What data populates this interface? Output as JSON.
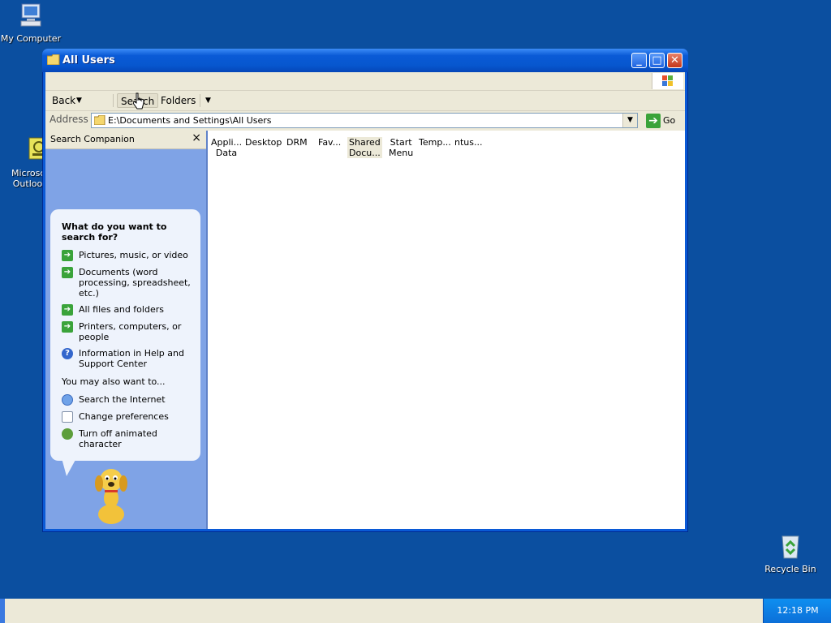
{
  "desktop": {
    "icons": [
      {
        "label": "My Computer",
        "icon": "my-computer-icon"
      },
      {
        "label": "Microsc Outloo",
        "icon": "outlook-icon"
      },
      {
        "label": "Recycle Bin",
        "icon": "recycle-bin-icon"
      }
    ]
  },
  "window": {
    "title": "All Users",
    "toolbar": {
      "back_label": "Back",
      "search_label": "Search",
      "folders_label": "Folders"
    },
    "address": {
      "label": "Address",
      "value": "E:\\Documents and Settings\\All Users",
      "go_label": "Go"
    },
    "search_companion": {
      "title": "Search Companion",
      "close_glyph": "×",
      "heading": "What do you want to search for?",
      "options": [
        {
          "label": "Pictures, music, or video",
          "icon": "arrow-icon"
        },
        {
          "label": "Documents (word processing, spreadsheet, etc.)",
          "icon": "arrow-icon"
        },
        {
          "label": "All files and folders",
          "icon": "arrow-icon"
        },
        {
          "label": "Printers, computers, or people",
          "icon": "arrow-icon"
        },
        {
          "label": "Information in Help and Support Center",
          "icon": "help-icon"
        }
      ],
      "also_label": "You may also want to...",
      "also_options": [
        {
          "label": "Search the Internet",
          "icon": "internet-search-icon"
        },
        {
          "label": "Change preferences",
          "icon": "preferences-icon"
        },
        {
          "label": "Turn off animated character",
          "icon": "character-icon"
        }
      ]
    },
    "files": [
      {
        "line1": "Appli...",
        "line2": "Data"
      },
      {
        "line1": "Desktop",
        "line2": ""
      },
      {
        "line1": "DRM",
        "line2": ""
      },
      {
        "line1": "Fav...",
        "line2": ""
      },
      {
        "line1": "Shared",
        "line2": "Docu..."
      },
      {
        "line1": "Start",
        "line2": "Menu"
      },
      {
        "line1": "Temp...",
        "line2": ""
      },
      {
        "line1": "ntus...",
        "line2": ""
      }
    ]
  },
  "taskbar": {
    "clock": "12:18 PM"
  },
  "colors": {
    "desktop": "#0b4fa0",
    "titlebar": "#0a5ad6",
    "pane": "#7fa3e6",
    "go_green": "#3aa33a"
  }
}
